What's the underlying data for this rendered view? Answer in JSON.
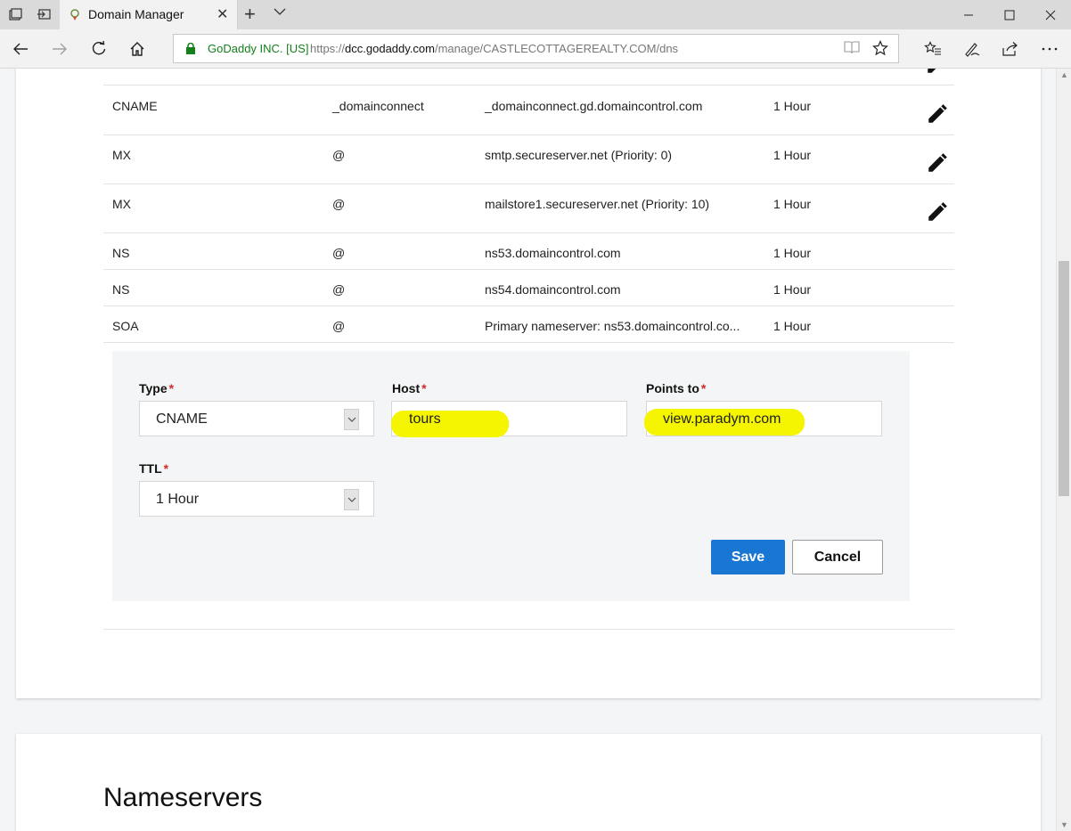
{
  "browser": {
    "tab_title": "Domain Manager",
    "site_identity": "GoDaddy INC. [US]",
    "url_prefix": "https://",
    "url_host": "dcc.godaddy.com",
    "url_path": "/manage/CASTLECOTTAGEREALTY.COM/dns"
  },
  "dns_records": [
    {
      "type": "CNAME",
      "name": "_domainconnect",
      "value": "_domainconnect.gd.domaincontrol.com",
      "ttl": "1 Hour",
      "editable": true
    },
    {
      "type": "MX",
      "name": "@",
      "value": "smtp.secureserver.net (Priority: 0)",
      "ttl": "1 Hour",
      "editable": true
    },
    {
      "type": "MX",
      "name": "@",
      "value": "mailstore1.secureserver.net (Priority: 10)",
      "ttl": "1 Hour",
      "editable": true
    },
    {
      "type": "NS",
      "name": "@",
      "value": "ns53.domaincontrol.com",
      "ttl": "1 Hour",
      "editable": false
    },
    {
      "type": "NS",
      "name": "@",
      "value": "ns54.domaincontrol.com",
      "ttl": "1 Hour",
      "editable": false
    },
    {
      "type": "SOA",
      "name": "@",
      "value": "Primary nameserver: ns53.domaincontrol.co...",
      "ttl": "1 Hour",
      "editable": false
    }
  ],
  "form": {
    "type_label": "Type",
    "type_value": "CNAME",
    "host_label": "Host",
    "host_value": "tours",
    "points_label": "Points to",
    "points_value": "view.paradym.com",
    "ttl_label": "TTL",
    "ttl_value": "1 Hour",
    "required_mark": "*",
    "save_label": "Save",
    "cancel_label": "Cancel",
    "highlight_color": "#f5f500"
  },
  "nameservers": {
    "title": "Nameservers"
  },
  "colors": {
    "primary_button": "#1976d2",
    "secure_text": "#14801c",
    "required": "#d62828"
  }
}
